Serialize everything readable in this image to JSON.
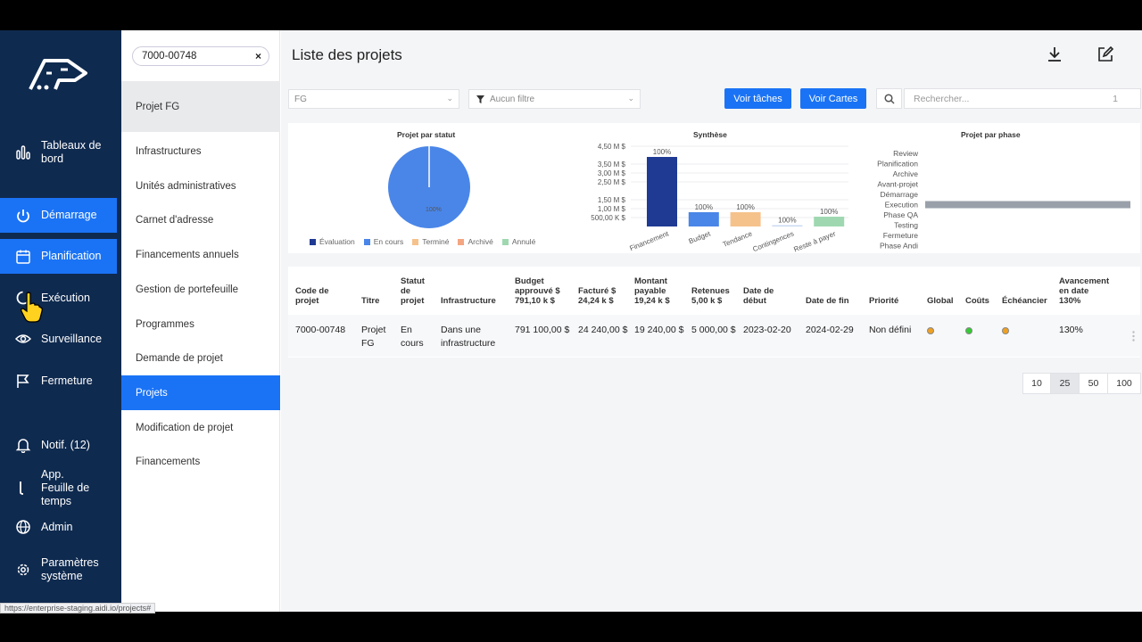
{
  "nav": {
    "items": [
      {
        "label": "Tableaux de bord",
        "icon": "bar-chart-icon"
      },
      {
        "label": "Démarrage",
        "icon": "power-icon"
      },
      {
        "label": "Planification",
        "icon": "calendar-icon"
      },
      {
        "label": "Exécution",
        "icon": "cycle-icon"
      },
      {
        "label": "Surveillance",
        "icon": "eye-icon"
      },
      {
        "label": "Fermeture",
        "icon": "flag-icon"
      },
      {
        "label": "Notif. (12)",
        "icon": "bell-icon"
      },
      {
        "label": "App. Feuille de temps",
        "icon": "timesheet-icon"
      },
      {
        "label": "Admin",
        "icon": "globe-icon"
      },
      {
        "label": "Paramètres système",
        "icon": "gear-icon"
      }
    ]
  },
  "submenu": {
    "search_value": "7000-00748",
    "clear_symbol": "×",
    "header": "Projet FG",
    "items": [
      "Infrastructures",
      "Unités administratives",
      "Carnet d'adresse",
      "Financements annuels",
      "Gestion de portefeuille",
      "Programmes",
      "Demande de projet",
      "Projets",
      "Modification de projet",
      "Financements"
    ]
  },
  "main": {
    "title": "Liste des projets",
    "filter_value": "FG",
    "filter_dropdown_value": "Aucun filtre",
    "btn_tasks": "Voir tâches",
    "btn_cards": "Voir Cartes",
    "search_placeholder": "Rechercher...",
    "search_count": "1"
  },
  "chart_data": [
    {
      "type": "pie",
      "title": "Projet par statut",
      "slices": [
        {
          "name": "Évaluation",
          "value": 0,
          "color": "#1f3a93"
        },
        {
          "name": "En cours",
          "value": 100,
          "color": "#4a86e8"
        },
        {
          "name": "Terminé",
          "value": 0,
          "color": "#f6c28b"
        },
        {
          "name": "Archivé",
          "value": 0,
          "color": "#f4a582"
        },
        {
          "name": "Annulé",
          "value": 0,
          "color": "#9fd8b0"
        }
      ],
      "slice_label": "100%"
    },
    {
      "type": "bar",
      "title": "Synthèse",
      "categories": [
        "Financement",
        "Budget",
        "Tendance",
        "Contingences",
        "Reste à payer"
      ],
      "values": [
        3.9,
        0.8,
        0.8,
        0.07,
        0.55
      ],
      "data_labels": [
        "100%",
        "100%",
        "100%",
        "100%",
        "100%"
      ],
      "colors": [
        "#1f3a93",
        "#4a86e8",
        "#f6c28b",
        "#c9d7f2",
        "#9fd8b0"
      ],
      "ytick_labels": [
        "4,50 M $",
        "3,50 M $",
        "3,00 M $",
        "2,50 M $",
        "1,50 M $",
        "1,00 M $",
        "500,00 K $"
      ],
      "ytick_values": [
        4.5,
        3.5,
        3.0,
        2.5,
        1.5,
        1.0,
        0.5
      ],
      "ylim": [
        0,
        4.6
      ]
    },
    {
      "type": "bar",
      "orientation": "horizontal",
      "title": "Projet par phase",
      "categories": [
        "Review",
        "Planification",
        "Archive",
        "Avant-projet",
        "Démarrage",
        "Execution",
        "Phase QA",
        "Testing",
        "Fermeture",
        "Phase Andi"
      ],
      "values": [
        0,
        0,
        0,
        0,
        0,
        1,
        0,
        0,
        0,
        0
      ],
      "color": "#9aa0aa",
      "xlim": [
        0,
        1
      ]
    }
  ],
  "table": {
    "headers": [
      "Code de projet",
      "Titre",
      "Statut de projet",
      "Infrastructure",
      "Budget approuvé $ 791,10 k $",
      "Facturé $ 24,24 k $",
      "Montant payable 19,24 k $",
      "Retenues 5,00 k $",
      "Date de début",
      "Date de fin",
      "Priorité",
      "Global",
      "Coûts",
      "Échéancier",
      "Avancement en date 130%"
    ],
    "row": {
      "code": "7000-00748",
      "titre": "Projet FG",
      "statut": "En cours",
      "infrastructure": "Dans une infrastructure",
      "budget": "791 100,00 $",
      "facture": "24 240,00 $",
      "payable": "19 240,00 $",
      "retenues": "5 000,00 $",
      "debut": "2023-02-20",
      "fin": "2024-02-29",
      "priorite": "Non défini",
      "global_color": "#f0a020",
      "couts_color": "#33cc33",
      "echeancier_color": "#f0a020",
      "avancement": "130%"
    }
  },
  "pagination": [
    "10",
    "25",
    "50",
    "100"
  ],
  "status_url": "https://enterprise-staging.aidi.io/projects#"
}
